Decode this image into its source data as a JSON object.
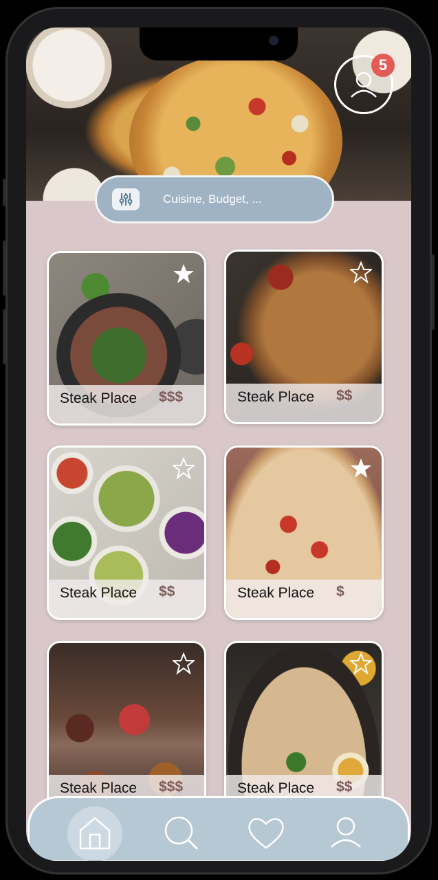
{
  "header": {
    "notification_count": "5"
  },
  "search": {
    "placeholder": "Cuisine, Budget, ..."
  },
  "restaurants": [
    {
      "name": "Steak Place",
      "price": "$$$",
      "starred": true
    },
    {
      "name": "Steak Place",
      "price": "$$",
      "starred": false
    },
    {
      "name": "Steak Place",
      "price": "$$",
      "starred": false
    },
    {
      "name": "Steak Place",
      "price": "$",
      "starred": true
    },
    {
      "name": "Steak Place",
      "price": "$$$",
      "starred": false
    },
    {
      "name": "Steak Place",
      "price": "$$",
      "starred": false
    }
  ],
  "nav": {
    "items": [
      "home-icon",
      "search-icon",
      "heart-icon",
      "profile-icon"
    ],
    "active": "home-icon"
  },
  "colors": {
    "background": "#d9c7c9",
    "nav": "#b7c8d5",
    "search": "#9fb3c5",
    "badge": "#e25b55",
    "price": "#7c5a5a"
  }
}
